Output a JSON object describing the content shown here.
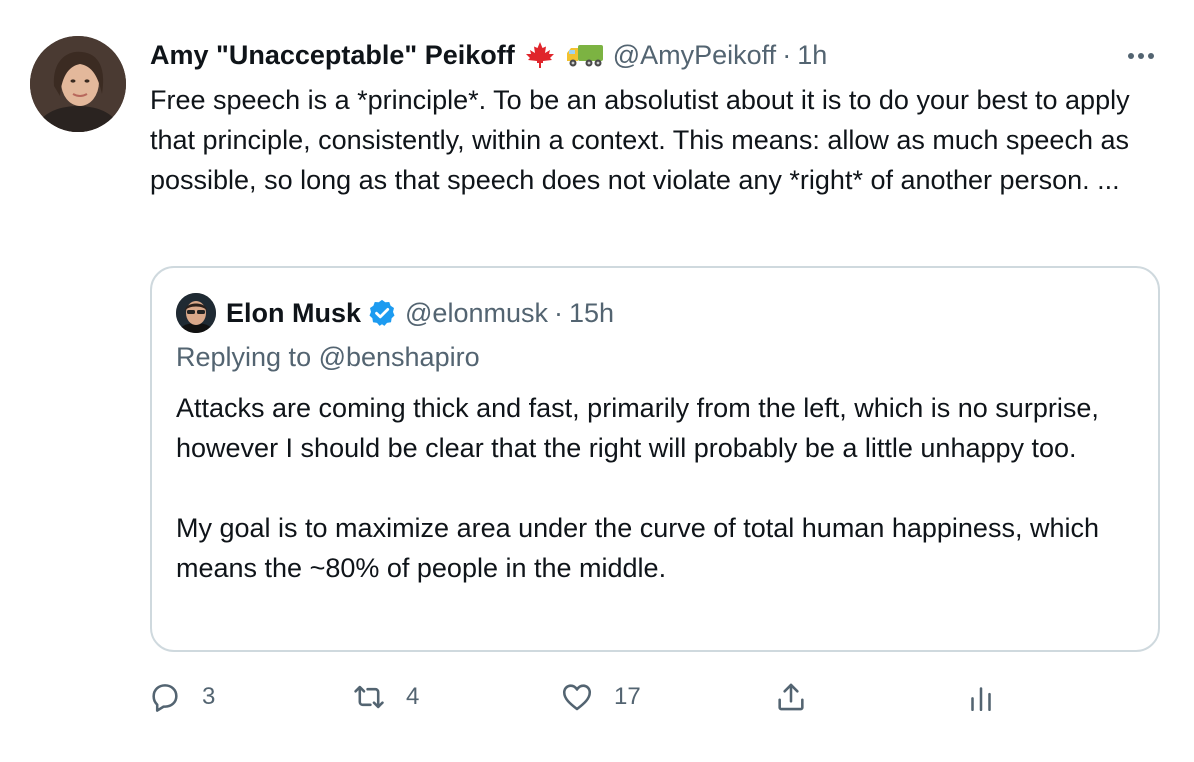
{
  "tweet": {
    "author": {
      "name": "Amy \"Unacceptable\" Peikoff",
      "emoji": [
        "maple-leaf",
        "delivery-truck"
      ],
      "handle": "@AmyPeikoff",
      "separator": "·",
      "time": "1h"
    },
    "text": "Free speech is a *principle*. To be an absolutist about it is to do your best to apply that principle, consistently, within a context. This means: allow as much speech as possible, so long as that speech does not violate any *right* of another person. ...",
    "quoted": {
      "name": "Elon Musk",
      "verified": true,
      "handle": "@elonmusk",
      "separator": "·",
      "time": "15h",
      "replying_to": "Replying to @benshapiro",
      "paragraphs": [
        "Attacks are coming thick and fast, primarily from the left, which is no surprise, however I should be clear that the right will probably be a little unhappy too.",
        "My goal is to maximize area under the curve of total human happiness, which means the ~80% of people in the middle."
      ]
    },
    "actions": {
      "reply_count": "3",
      "retweet_count": "4",
      "like_count": "17"
    }
  },
  "colors": {
    "text": "#0f1419",
    "secondary": "#536471",
    "border": "#cfd9de",
    "verified": "#1d9bf0",
    "maple": "#e0242b",
    "truck_cab": "#f2c230",
    "truck_cargo": "#7cb342"
  },
  "icons": {
    "more": "more-icon",
    "reply": "reply-icon",
    "retweet": "retweet-icon",
    "like": "heart-icon",
    "share": "share-icon",
    "analytics": "analytics-icon"
  }
}
